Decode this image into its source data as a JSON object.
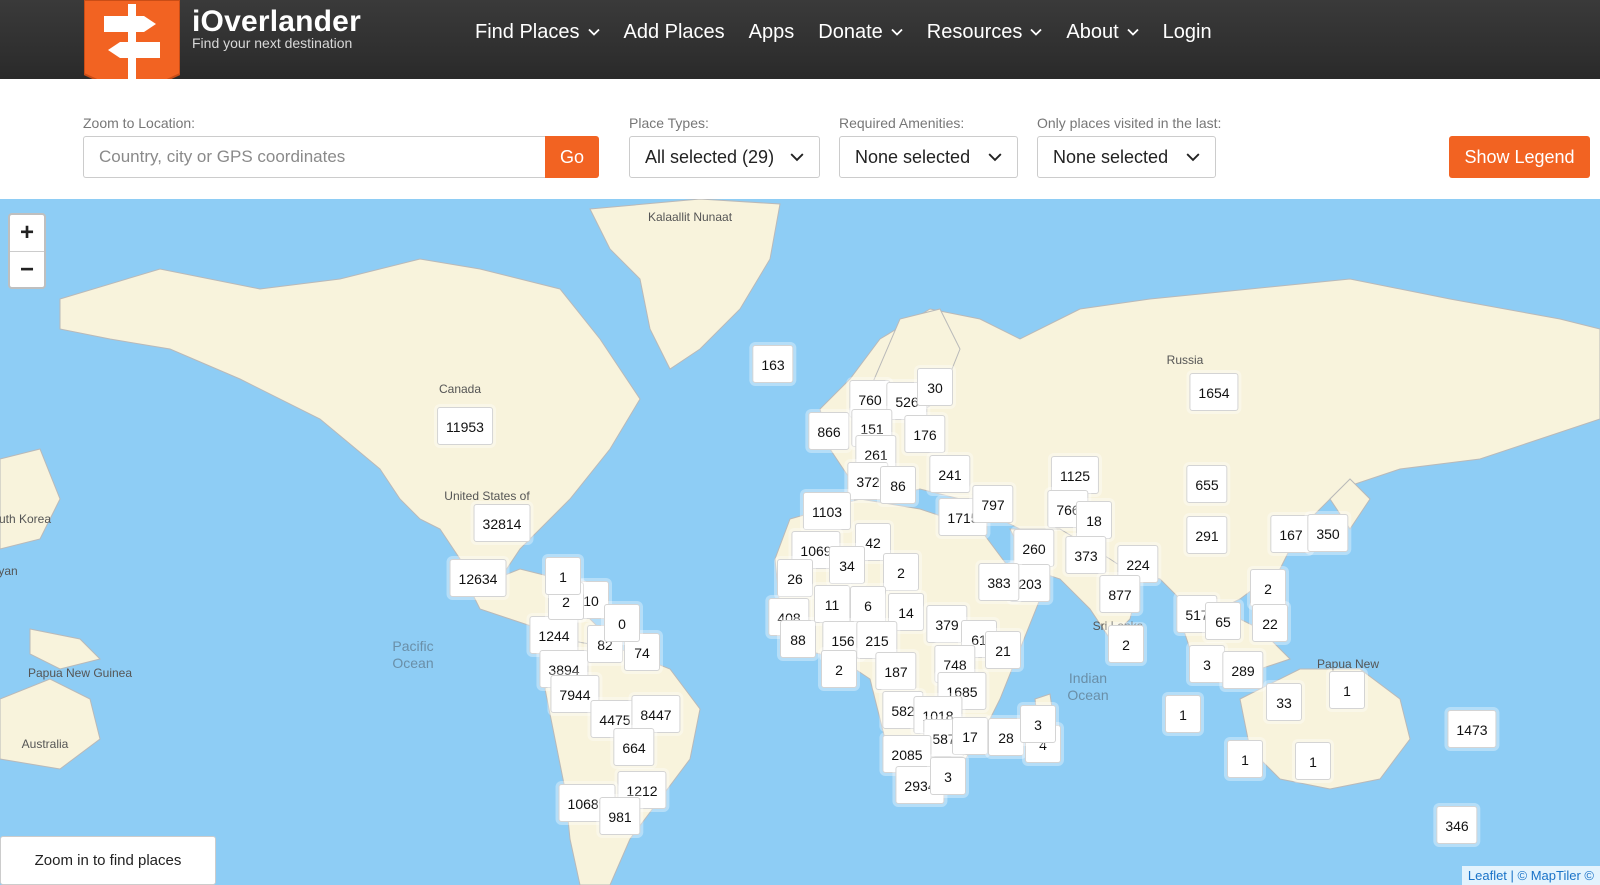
{
  "brand": {
    "name": "iOverlander",
    "tagline": "Find your next destination"
  },
  "nav": [
    {
      "label": "Find Places",
      "dropdown": true
    },
    {
      "label": "Add Places",
      "dropdown": false
    },
    {
      "label": "Apps",
      "dropdown": false
    },
    {
      "label": "Donate",
      "dropdown": true
    },
    {
      "label": "Resources",
      "dropdown": true
    },
    {
      "label": "About",
      "dropdown": true
    },
    {
      "label": "Login",
      "dropdown": false
    }
  ],
  "filters": {
    "zoom_label": "Zoom to Location:",
    "zoom_placeholder": "Country, city or GPS coordinates",
    "go_label": "Go",
    "place_types_label": "Place Types:",
    "place_types_value": "All selected (29)",
    "amenities_label": "Required Amenities:",
    "amenities_value": "None selected",
    "visited_label": "Only places visited in the last:",
    "visited_value": "None selected",
    "legend_label": "Show Legend"
  },
  "colors": {
    "accent": "#f26322",
    "topbar": "#2f2f2f",
    "ocean": "#8ecdf5",
    "land": "#f8f3dc"
  },
  "map": {
    "zoom_in": "+",
    "zoom_out": "−",
    "labels": [
      "Kalaallit Nunaat",
      "Canada",
      "United States of",
      "Russia",
      "uth Korea",
      "yan",
      "Papua New Guinea",
      "Australia",
      "Sri Lanka",
      "Papua New"
    ],
    "oceans": [
      "Pacific Ocean",
      "Indian Ocean"
    ],
    "clusters": [
      "163",
      "11953",
      "32814",
      "12634",
      "1244",
      "3894",
      "7944",
      "4475",
      "8447",
      "664",
      "1212",
      "10689",
      "981",
      "10",
      "2",
      "82",
      "74",
      "0",
      "1",
      "760",
      "526",
      "30",
      "866",
      "151",
      "176",
      "261",
      "372",
      "86",
      "241",
      "1103",
      "42",
      "1715",
      "797",
      "1125",
      "766",
      "18",
      "1069",
      "34",
      "26",
      "2",
      "260",
      "203",
      "383",
      "373",
      "224",
      "877",
      "408",
      "88",
      "11",
      "6",
      "14",
      "156",
      "215",
      "379",
      "61",
      "21",
      "2",
      "187",
      "748",
      "1685",
      "582",
      "1018",
      "587",
      "17",
      "28",
      "4",
      "2085",
      "2934",
      "3",
      "1654",
      "655",
      "291",
      "167",
      "350",
      "2",
      "517",
      "65",
      "22",
      "3",
      "289",
      "2",
      "1",
      "33",
      "1",
      "1473",
      "1",
      "346",
      "1",
      "3"
    ],
    "zoom_hint": "Zoom in to find places",
    "attribution": "Leaflet | © MapTiler ©"
  }
}
